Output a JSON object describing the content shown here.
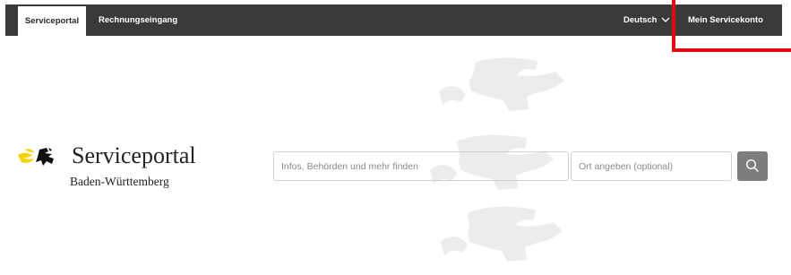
{
  "nav": {
    "tabs": [
      {
        "label": "Serviceportal",
        "active": true
      },
      {
        "label": "Rechnungseingang",
        "active": false
      }
    ],
    "language": "Deutsch",
    "account": "Mein Servicekonto"
  },
  "logo": {
    "title": "Serviceportal",
    "subtitle": "Baden-Württemberg"
  },
  "search": {
    "query_placeholder": "Infos, Behörden und mehr finden",
    "location_placeholder": "Ort angeben (optional)",
    "button_icon": "search-icon"
  },
  "colors": {
    "navbar": "#3a3a3a",
    "highlight": "#e30613",
    "logo_yellow": "#f6d200",
    "button": "#7d7d7d"
  }
}
